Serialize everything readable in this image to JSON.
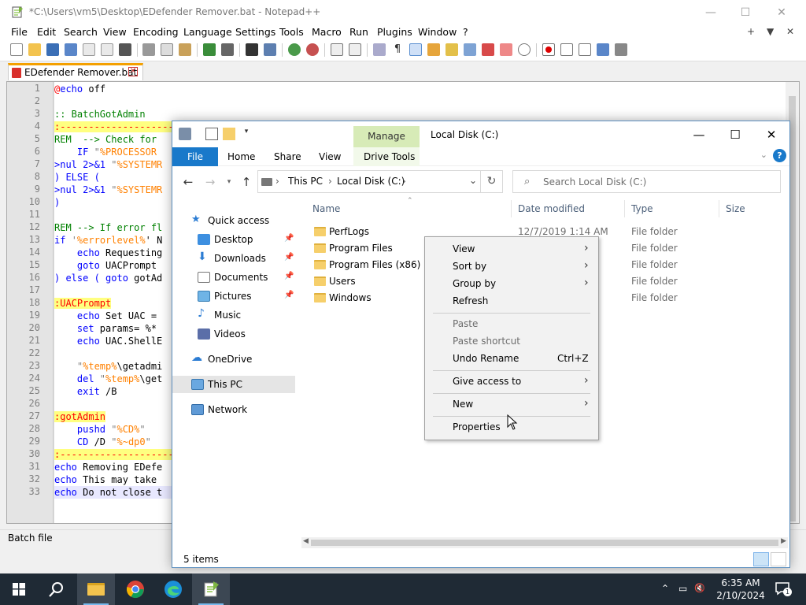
{
  "notepad": {
    "title": "*C:\\Users\\vm5\\Desktop\\EDefender Remover.bat - Notepad++",
    "menu": [
      "File",
      "Edit",
      "Search",
      "View",
      "Encoding",
      "Language",
      "Settings",
      "Tools",
      "Macro",
      "Run",
      "Plugins",
      "Window",
      "?"
    ],
    "menu_right": [
      "+",
      "▼",
      "✕"
    ],
    "tab_label": "EDefender Remover.bat",
    "status": "Batch file",
    "line_numbers": [
      "1",
      "2",
      "3",
      "4",
      "5",
      "6",
      "7",
      "8",
      "9",
      "10",
      "11",
      "12",
      "13",
      "14",
      "15",
      "16",
      "17",
      "18",
      "19",
      "20",
      "21",
      "22",
      "23",
      "24",
      "25",
      "26",
      "27",
      "28",
      "29",
      "30",
      "31",
      "32",
      "33"
    ],
    "lines": [
      {
        "segs": [
          {
            "t": "@",
            "c": "#ff0000"
          },
          {
            "t": "echo",
            "c": "#0000ff"
          },
          {
            "t": " off",
            "c": "#000000"
          }
        ]
      },
      {
        "segs": []
      },
      {
        "segs": [
          {
            "t": ":: BatchGotAdmin",
            "c": "#008000"
          }
        ]
      },
      {
        "label": true,
        "segs": [
          {
            "t": ":------------------------------------------",
            "c": "#ff0000"
          }
        ]
      },
      {
        "segs": [
          {
            "t": "REM  --> Check for",
            "c": "#008000"
          }
        ]
      },
      {
        "segs": [
          {
            "t": "    IF ",
            "c": "#0000ff"
          },
          {
            "t": "\"",
            "c": "#808080"
          },
          {
            "t": "%PROCESSOR",
            "c": "#ff8000"
          }
        ]
      },
      {
        "segs": [
          {
            "t": ">nul 2>&1 ",
            "c": "#0000ff"
          },
          {
            "t": "\"",
            "c": "#808080"
          },
          {
            "t": "%SYSTEMR",
            "c": "#ff8000"
          }
        ]
      },
      {
        "segs": [
          {
            "t": ") ELSE (",
            "c": "#0000ff"
          }
        ]
      },
      {
        "segs": [
          {
            "t": ">nul 2>&1 ",
            "c": "#0000ff"
          },
          {
            "t": "\"",
            "c": "#808080"
          },
          {
            "t": "%SYSTEMR",
            "c": "#ff8000"
          }
        ]
      },
      {
        "segs": [
          {
            "t": ")",
            "c": "#0000ff"
          }
        ]
      },
      {
        "segs": []
      },
      {
        "segs": [
          {
            "t": "REM --> If error fl",
            "c": "#008000"
          }
        ]
      },
      {
        "segs": [
          {
            "t": "if ",
            "c": "#0000ff"
          },
          {
            "t": "'",
            "c": "#808080"
          },
          {
            "t": "%errorlevel%",
            "c": "#ff8000"
          },
          {
            "t": "' N",
            "c": "#000000"
          }
        ]
      },
      {
        "segs": [
          {
            "t": "    echo ",
            "c": "#0000ff"
          },
          {
            "t": "Requesting",
            "c": "#000000"
          }
        ]
      },
      {
        "segs": [
          {
            "t": "    goto ",
            "c": "#0000ff"
          },
          {
            "t": "UACPrompt",
            "c": "#000000"
          }
        ]
      },
      {
        "segs": [
          {
            "t": ") else ( goto ",
            "c": "#0000ff"
          },
          {
            "t": "gotAd",
            "c": "#000000"
          }
        ]
      },
      {
        "segs": []
      },
      {
        "label": true,
        "segs": [
          {
            "t": ":UACPrompt",
            "c": "#ff0000"
          }
        ]
      },
      {
        "segs": [
          {
            "t": "    echo ",
            "c": "#0000ff"
          },
          {
            "t": "Set UAC =",
            "c": "#000000"
          }
        ]
      },
      {
        "segs": [
          {
            "t": "    set ",
            "c": "#0000ff"
          },
          {
            "t": "params= %*",
            "c": "#000000"
          }
        ]
      },
      {
        "segs": [
          {
            "t": "    echo ",
            "c": "#0000ff"
          },
          {
            "t": "UAC.ShellE",
            "c": "#000000"
          }
        ]
      },
      {
        "segs": []
      },
      {
        "segs": [
          {
            "t": "    \"",
            "c": "#808080"
          },
          {
            "t": "%temp%",
            "c": "#ff8000"
          },
          {
            "t": "\\getadmi",
            "c": "#000000"
          }
        ]
      },
      {
        "segs": [
          {
            "t": "    del ",
            "c": "#0000ff"
          },
          {
            "t": "\"",
            "c": "#808080"
          },
          {
            "t": "%temp%",
            "c": "#ff8000"
          },
          {
            "t": "\\get",
            "c": "#000000"
          }
        ]
      },
      {
        "segs": [
          {
            "t": "    exit ",
            "c": "#0000ff"
          },
          {
            "t": "/B",
            "c": "#000000"
          }
        ]
      },
      {
        "segs": []
      },
      {
        "label": true,
        "segs": [
          {
            "t": ":gotAdmin",
            "c": "#ff0000"
          }
        ]
      },
      {
        "segs": [
          {
            "t": "    pushd ",
            "c": "#0000ff"
          },
          {
            "t": "\"",
            "c": "#808080"
          },
          {
            "t": "%CD%",
            "c": "#ff8000"
          },
          {
            "t": "\"",
            "c": "#808080"
          }
        ]
      },
      {
        "segs": [
          {
            "t": "    CD ",
            "c": "#0000ff"
          },
          {
            "t": "/D ",
            "c": "#000000"
          },
          {
            "t": "\"",
            "c": "#808080"
          },
          {
            "t": "%~dp0",
            "c": "#ff8000"
          },
          {
            "t": "\"",
            "c": "#808080"
          }
        ]
      },
      {
        "label": true,
        "segs": [
          {
            "t": ":------------------------------------------",
            "c": "#ff0000"
          }
        ]
      },
      {
        "segs": [
          {
            "t": "echo ",
            "c": "#0000ff"
          },
          {
            "t": "Removing EDefe",
            "c": "#000000"
          }
        ]
      },
      {
        "segs": [
          {
            "t": "echo ",
            "c": "#0000ff"
          },
          {
            "t": "This may take",
            "c": "#000000"
          }
        ]
      },
      {
        "current": true,
        "segs": [
          {
            "t": "echo ",
            "c": "#0000ff"
          },
          {
            "t": "Do not close t",
            "c": "#000000"
          }
        ]
      }
    ]
  },
  "explorer": {
    "title": "Local Disk (C:)",
    "manage_tab": "Manage",
    "ribbon_tabs": [
      "File",
      "Home",
      "Share",
      "View",
      "Drive Tools"
    ],
    "help": "?",
    "breadcrumb": [
      "This PC",
      "Local Disk (C:)"
    ],
    "search_placeholder": "Search Local Disk (C:)",
    "nav": {
      "quick_access": "Quick access",
      "desktop": "Desktop",
      "downloads": "Downloads",
      "documents": "Documents",
      "pictures": "Pictures",
      "music": "Music",
      "videos": "Videos",
      "onedrive": "OneDrive",
      "this_pc": "This PC",
      "network": "Network"
    },
    "columns": {
      "name": "Name",
      "date": "Date modified",
      "type": "Type",
      "size": "Size"
    },
    "files": [
      {
        "name": "PerfLogs",
        "date": "12/7/2019 1:14 AM",
        "type": "File folder"
      },
      {
        "name": "Program Files",
        "date": "",
        "type": "File folder"
      },
      {
        "name": "Program Files (x86)",
        "date": "",
        "type": "File folder"
      },
      {
        "name": "Users",
        "date": "",
        "type": "File folder"
      },
      {
        "name": "Windows",
        "date": "",
        "type": "File folder"
      }
    ],
    "status": "5 items"
  },
  "context_menu": {
    "view": "View",
    "sort_by": "Sort by",
    "group_by": "Group by",
    "refresh": "Refresh",
    "paste": "Paste",
    "paste_shortcut": "Paste shortcut",
    "undo_rename": "Undo Rename",
    "undo_shortcut": "Ctrl+Z",
    "give_access": "Give access to",
    "new": "New",
    "properties": "Properties"
  },
  "taskbar": {
    "time": "6:35 AM",
    "date": "2/10/2024",
    "notification_count": "1"
  },
  "colors": {
    "accent": "#1979ca",
    "manage": "#d7ebb7",
    "label_bg": "#ffff80",
    "current_line": "#e8e8ff",
    "taskbar": "#1f2a35"
  }
}
